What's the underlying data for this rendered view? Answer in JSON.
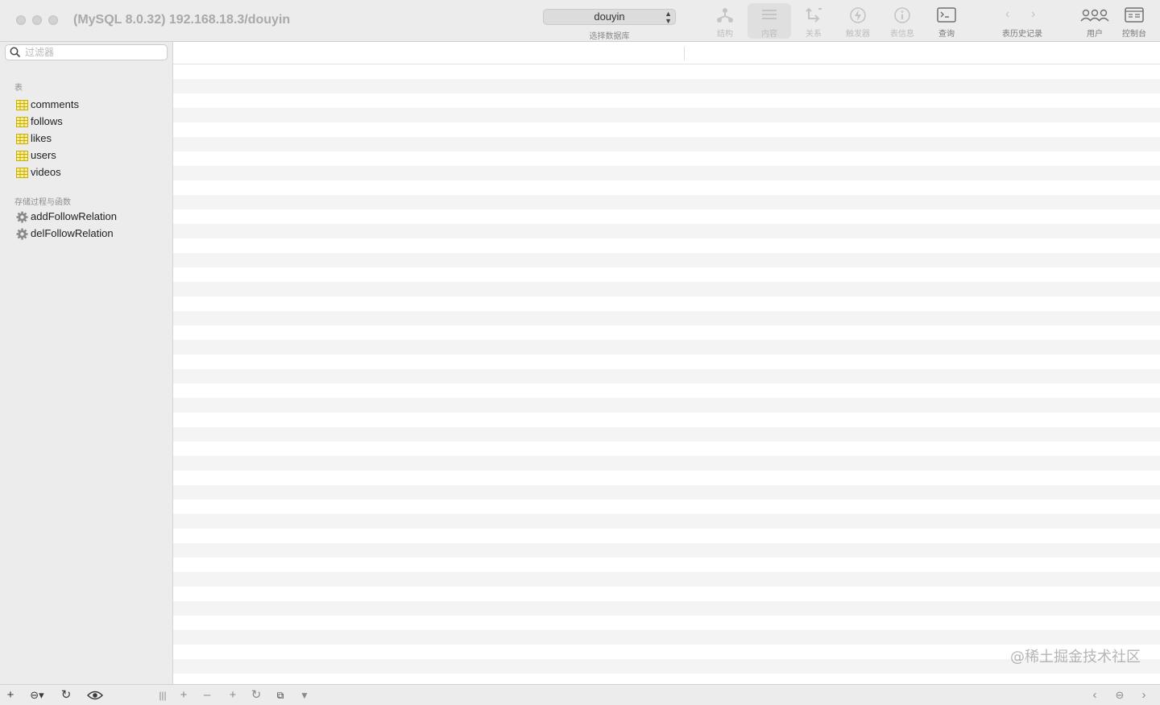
{
  "window": {
    "title": "(MySQL 8.0.32) 192.168.18.3/douyin"
  },
  "toolbar": {
    "database_select": {
      "value": "douyin",
      "caption": "选择数据库"
    },
    "buttons": [
      {
        "label": "结构",
        "icon": "structure-icon",
        "active": false,
        "enabled": false
      },
      {
        "label": "内容",
        "icon": "content-icon",
        "active": true,
        "enabled": false
      },
      {
        "label": "关系",
        "icon": "relations-icon",
        "active": false,
        "enabled": false
      },
      {
        "label": "触发器",
        "icon": "triggers-icon",
        "active": false,
        "enabled": false
      },
      {
        "label": "表信息",
        "icon": "table-info-icon",
        "active": false,
        "enabled": false
      },
      {
        "label": "查询",
        "icon": "query-icon",
        "active": false,
        "enabled": true
      }
    ],
    "history_label": "表历史记录",
    "users_label": "用户",
    "console_label": "控制台"
  },
  "sidebar": {
    "filter_placeholder": "过滤器",
    "tables_title": "表",
    "tables": [
      {
        "label": "comments"
      },
      {
        "label": "follows"
      },
      {
        "label": "likes"
      },
      {
        "label": "users"
      },
      {
        "label": "videos"
      }
    ],
    "routines_title": "存储过程与函数",
    "routines": [
      {
        "label": "addFollowRelation"
      },
      {
        "label": "delFollowRelation"
      }
    ]
  },
  "watermark": "@稀土掘金技术社区",
  "colors": {
    "window_bg": "#ececec",
    "row_stripe": "#f4f4f4",
    "table_icon": "#c9b000"
  }
}
